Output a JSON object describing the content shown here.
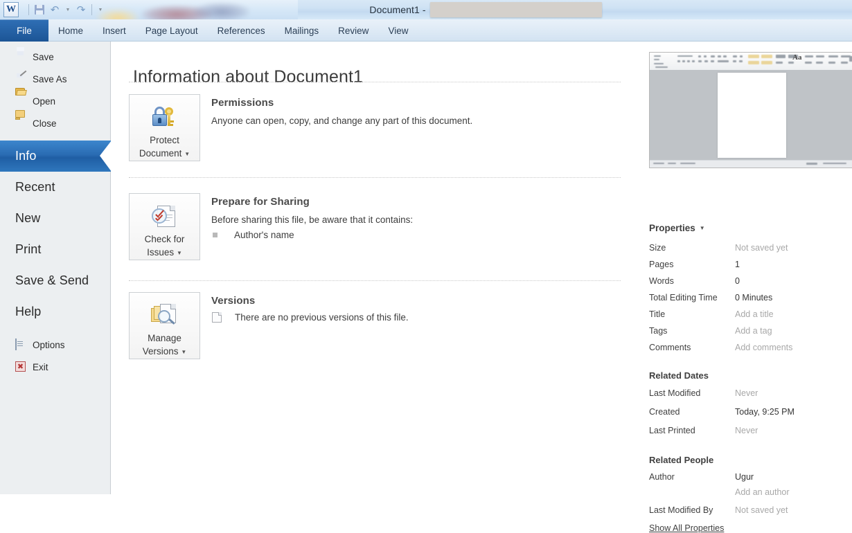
{
  "titlebar": {
    "document_title": "Document1 -",
    "app_logo": "W"
  },
  "quick_access": {
    "save_icon": "save-icon",
    "undo_icon": "undo-icon",
    "redo_icon": "redo-icon",
    "customize_icon": "chevron-down-icon"
  },
  "ribbon": {
    "tabs": [
      {
        "label": "File",
        "active": true
      },
      {
        "label": "Home",
        "active": false
      },
      {
        "label": "Insert",
        "active": false
      },
      {
        "label": "Page Layout",
        "active": false
      },
      {
        "label": "References",
        "active": false
      },
      {
        "label": "Mailings",
        "active": false
      },
      {
        "label": "Review",
        "active": false
      },
      {
        "label": "View",
        "active": false
      }
    ]
  },
  "sidebar": {
    "commands": [
      {
        "label": "Save",
        "icon": "save-icon"
      },
      {
        "label": "Save As",
        "icon": "save-as-icon"
      },
      {
        "label": "Open",
        "icon": "open-folder-icon"
      },
      {
        "label": "Close",
        "icon": "close-folder-icon"
      }
    ],
    "pages": [
      {
        "label": "Info",
        "active": true
      },
      {
        "label": "Recent",
        "active": false
      },
      {
        "label": "New",
        "active": false
      },
      {
        "label": "Print",
        "active": false
      },
      {
        "label": "Save & Send",
        "active": false
      },
      {
        "label": "Help",
        "active": false
      }
    ],
    "footer": [
      {
        "label": "Options",
        "icon": "options-icon"
      },
      {
        "label": "Exit",
        "icon": "exit-icon"
      }
    ]
  },
  "main": {
    "page_title": "Information about Document1",
    "sections": [
      {
        "button_line1": "Protect",
        "button_line2": "Document",
        "button_icon": "lock-key-icon",
        "heading": "Permissions",
        "body": "Anyone can open, copy, and change any part of this document."
      },
      {
        "button_line1": "Check for",
        "button_line2": "Issues",
        "button_icon": "document-inspector-icon",
        "heading": "Prepare for Sharing",
        "body": "Before sharing this file, be aware that it contains:",
        "bullets": [
          "Author's name"
        ]
      },
      {
        "button_line1": "Manage",
        "button_line2": "Versions",
        "button_icon": "manage-versions-icon",
        "heading": "Versions",
        "version_note": "There are no previous versions of this file."
      }
    ]
  },
  "right_panel": {
    "thumbnail_alt": "document-preview-thumbnail",
    "properties_label": "Properties",
    "properties": [
      {
        "key": "Size",
        "value": "Not saved yet",
        "muted": true
      },
      {
        "key": "Pages",
        "value": "1",
        "muted": false
      },
      {
        "key": "Words",
        "value": "0",
        "muted": false
      },
      {
        "key": "Total Editing Time",
        "value": "0 Minutes",
        "muted": false
      },
      {
        "key": "Title",
        "value": "Add a title",
        "muted": true
      },
      {
        "key": "Tags",
        "value": "Add a tag",
        "muted": true
      },
      {
        "key": "Comments",
        "value": "Add comments",
        "muted": true
      }
    ],
    "related_dates_label": "Related Dates",
    "related_dates": [
      {
        "key": "Last Modified",
        "value": "Never",
        "muted": true
      },
      {
        "key": "Created",
        "value": "Today, 9:25 PM",
        "muted": false
      },
      {
        "key": "Last Printed",
        "value": "Never",
        "muted": true
      }
    ],
    "related_people_label": "Related People",
    "related_people": [
      {
        "key": "Author",
        "value": "Ugur",
        "muted": false
      },
      {
        "key": "",
        "value": "Add an author",
        "muted": true
      },
      {
        "key": "Last Modified By",
        "value": "Not saved yet",
        "muted": true
      }
    ],
    "show_all_properties": "Show All Properties"
  },
  "colors": {
    "accent_blue": "#2a6cb3",
    "file_tab_blue": "#1c5596",
    "titlebar_blue": "#cfe2f4",
    "sidebar_gray": "#eceff1",
    "redaction_gray": "#d4d0cb"
  }
}
